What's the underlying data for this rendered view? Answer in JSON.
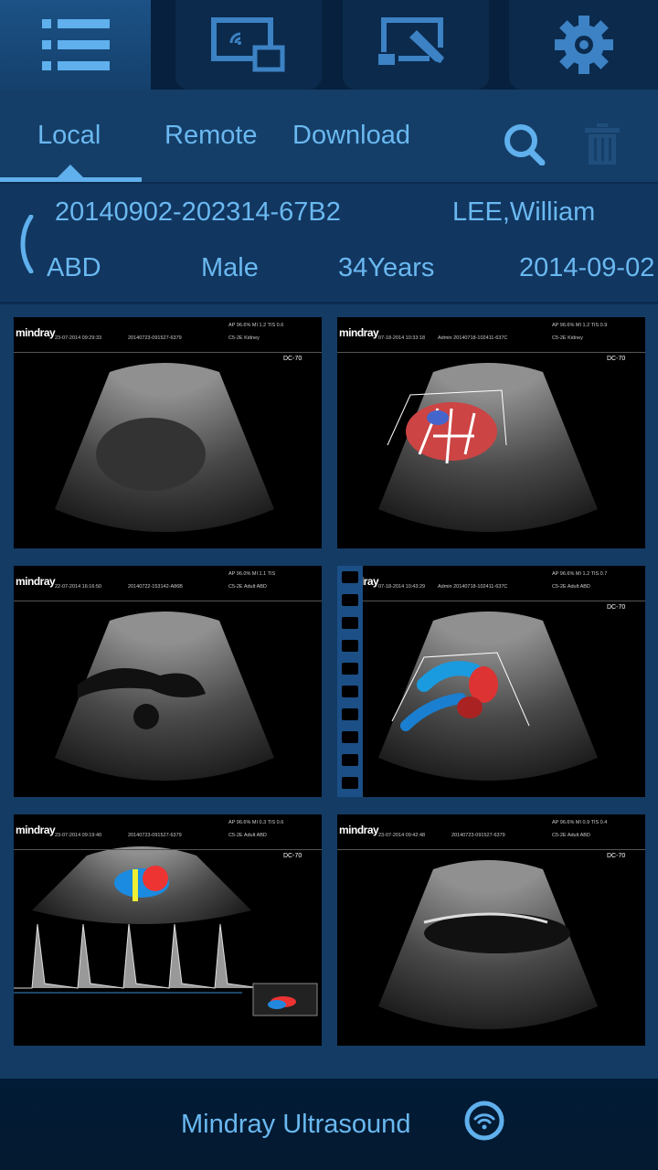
{
  "top_tabs": [
    {
      "icon": "list-icon",
      "active": true
    },
    {
      "icon": "wireless-display-icon",
      "active": false
    },
    {
      "icon": "screen-annotate-icon",
      "active": false
    },
    {
      "icon": "gear-icon",
      "active": false
    }
  ],
  "sub_tabs": {
    "local": "Local",
    "remote": "Remote",
    "download": "Download",
    "active": "Local"
  },
  "actions": {
    "search": "search-icon",
    "delete": "trash-icon"
  },
  "patient": {
    "id": "20140902-202314-67B2",
    "name": "LEE,William",
    "exam": "ABD",
    "sex": "Male",
    "age": "34Years",
    "date": "2014-09-02"
  },
  "thumbnails": [
    {
      "type": "bmode",
      "datetime": "23-07-2014 09:29:33",
      "study": "20140723-091527-6379",
      "params": "AP 96.6%  MI 1.2  TIS 0.6",
      "probe": "C5-2E",
      "exam": "Kidney",
      "dc": "DC-70"
    },
    {
      "type": "color",
      "datetime": "07-18-2014 10:33:18",
      "operator": "Admin",
      "study": "20140718-102411-637C",
      "params": "AP 96.6%  MI 1.2  TIS 0.9",
      "probe": "C5-2E",
      "exam": "Kidney",
      "dc": "DC-70"
    },
    {
      "type": "bmode2",
      "datetime": "22-07-2014 16:16:50",
      "study": "20140722-153142-A86B",
      "params": "AP 96.0%  MI 1.1  TIS",
      "probe": "C5-2E",
      "exam": "Adult ABD",
      "dc": ""
    },
    {
      "type": "color2",
      "datetime": "07-18-2014 10:43:29",
      "operator": "Admin",
      "study": "20140718-102411-637C",
      "params": "AP 96.6%  MI 1.2  TIS 0.7",
      "probe": "C5-2E",
      "exam": "Adult ABD",
      "dc": "DC-70",
      "selected": true
    },
    {
      "type": "doppler",
      "datetime": "23-07-2014 09:19:40",
      "study": "20140723-091527-6379",
      "params": "AP 96.6%  MI 0.3  TIS 0.6",
      "probe": "C5-2E",
      "exam": "Adult ABD",
      "dc": "DC-70"
    },
    {
      "type": "bmode3",
      "datetime": "23-07-2014 09:42:48",
      "study": "20140723-091527-6379",
      "params": "AP 96.6%  MI 0.9  TIS 0.4",
      "probe": "C5-2E",
      "exam": "Adult ABD",
      "dc": "DC-70"
    }
  ],
  "brand": "mindray",
  "footer": {
    "device_name": "Mindray Ultrasound",
    "status_icon": "wifi-icon"
  },
  "colors": {
    "accent": "#6ab8f0",
    "header_bg": "#06203d",
    "panel_bg": "#133b64",
    "footer_bg": "#021b36"
  }
}
